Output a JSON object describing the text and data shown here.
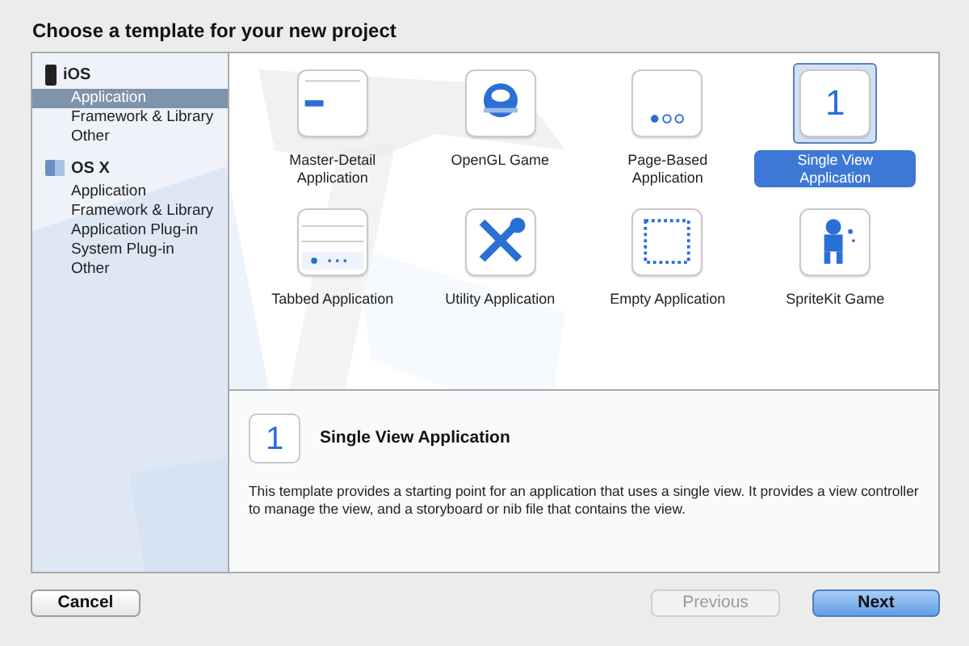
{
  "title": "Choose a template for your new project",
  "sidebar": {
    "groups": [
      {
        "label": "iOS",
        "kind": "device",
        "items": [
          {
            "label": "Application",
            "selected": true
          },
          {
            "label": "Framework & Library",
            "selected": false
          },
          {
            "label": "Other",
            "selected": false
          }
        ]
      },
      {
        "label": "OS X",
        "kind": "desktop",
        "items": [
          {
            "label": "Application",
            "selected": false
          },
          {
            "label": "Framework & Library",
            "selected": false
          },
          {
            "label": "Application Plug-in",
            "selected": false
          },
          {
            "label": "System Plug-in",
            "selected": false
          },
          {
            "label": "Other",
            "selected": false
          }
        ]
      }
    ]
  },
  "templates": [
    {
      "label": "Master-Detail Application",
      "kind": "master-detail",
      "selected": false
    },
    {
      "label": "OpenGL Game",
      "kind": "opengl",
      "selected": false
    },
    {
      "label": "Page-Based Application",
      "kind": "page-based",
      "selected": false
    },
    {
      "label": "Single View Application",
      "kind": "single-view",
      "glyph": "1",
      "selected": true
    },
    {
      "label": "Tabbed Application",
      "kind": "tabbed",
      "selected": false
    },
    {
      "label": "Utility Application",
      "kind": "utility",
      "selected": false
    },
    {
      "label": "Empty Application",
      "kind": "empty",
      "selected": false
    },
    {
      "label": "SpriteKit Game",
      "kind": "spritekit",
      "selected": false
    }
  ],
  "detail": {
    "glyph": "1",
    "title": "Single View Application",
    "description": "This template provides a starting point for an application that uses a single view. It provides a view controller to manage the view, and a storyboard or nib file that contains the view."
  },
  "buttons": [
    {
      "label": "Cancel",
      "kind": "plain",
      "disabled": false
    },
    {
      "label": "Previous",
      "kind": "plain",
      "disabled": true
    },
    {
      "label": "Next",
      "kind": "default",
      "disabled": false
    }
  ]
}
